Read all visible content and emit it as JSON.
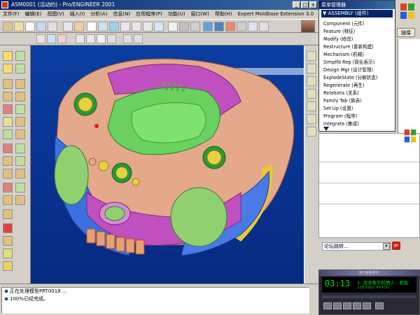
{
  "window": {
    "title": "ASM0001 (活动的) - Pro/ENGINEER 2001",
    "min_glyph": "_",
    "max_glyph": "□",
    "close_glyph": "x"
  },
  "menubar": {
    "items": [
      "文件(F)",
      "编辑(E)",
      "视图(V)",
      "插入(I)",
      "分析(A)",
      "信息(N)",
      "应用程序(P)",
      "功能(U)",
      "窗口(W)",
      "帮助(H)",
      "Expert Moldbase Extension 3.0"
    ]
  },
  "menu_manager": {
    "title": "菜单管理器",
    "header": "▼ ASSEMBLY (组件)",
    "items": [
      "Component (元件)",
      "Feature (特征)",
      "Modify (修改)",
      "Restructure (重新构建)",
      "Mechanism (机械)",
      "Simplfd Rep (简化表示)",
      "Design Mgr (设计管理)",
      "ExplodeState (分解状态)",
      "Regenerate (再生)",
      "Relations (关系)",
      "Family Tab (族表)",
      "Set Up (设置)",
      "Program (程序)",
      "Integrate (集成)"
    ]
  },
  "messages": [
    "正在处理模型PRT0018 ...",
    "100%已经完成。"
  ],
  "browser": {
    "link_label": "链接",
    "forum_select": "论坛跳转...",
    "go_label": "go",
    "dropdown_glyph": "▾"
  },
  "winamp": {
    "title": "WINAMP",
    "time": "03:13",
    "track": "1. 流浪歌手的情人 - 老狼",
    "info": "128 kbps  44 kHz"
  },
  "colors": {
    "title_bar": "#0a246a",
    "viewport_bg": "#0a3ea0",
    "model_body": "#e4a88a",
    "model_top": "#6ad060",
    "model_accent": "#c050c0",
    "model_blue": "#3a70e0"
  }
}
